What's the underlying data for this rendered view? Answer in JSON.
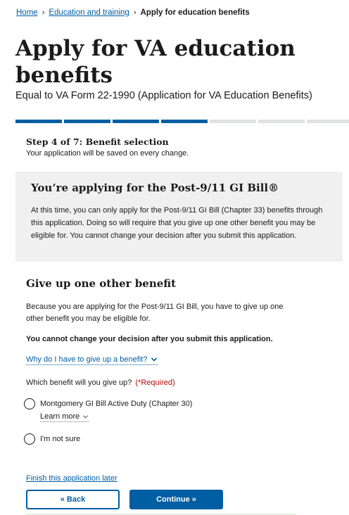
{
  "breadcrumb": {
    "items": [
      "Home",
      "Education and training"
    ],
    "current": "Apply for education benefits"
  },
  "page": {
    "title": "Apply for VA education benefits",
    "subtitle": "Equal to VA Form 22-1990 (Application for VA Education Benefits)"
  },
  "progress": {
    "total_steps": 7,
    "completed_steps": 4
  },
  "step": {
    "title": "Step 4 of 7: Benefit selection",
    "note": "Your application will be saved on every change."
  },
  "alert": {
    "heading": "You’re applying for the Post-9/11 GI Bill®",
    "body": "At this time, you can only apply for the Post-9/11 GI Bill (Chapter 33) benefits through this application. Doing so will require that you give up one other benefit you may be eligible for. You cannot change your decision after you submit this application."
  },
  "section": {
    "heading": "Give up one other benefit",
    "text": "Because you are applying for the Post-9/11 GI Bill, you have to give up one other benefit you may be eligible for.",
    "bold_text": "You cannot change your decision after you submit this application.",
    "why_link": "Why do I have to give up a benefit?"
  },
  "question": {
    "label": "Which benefit will you give up?",
    "required": "(*Required)",
    "options": [
      {
        "label": "Montgomery GI Bill Active Duty (Chapter 30)",
        "learn_more": "Learn more"
      },
      {
        "label": "I'm not sure"
      }
    ]
  },
  "footer": {
    "finish_later": "Finish this application later",
    "back_label": "« Back",
    "continue_label": "Continue »"
  },
  "colors": {
    "primary": "#005ea2",
    "required": "#b50909",
    "alert_bg": "#f0f0f0",
    "progress_inactive": "#dfe1e2"
  }
}
